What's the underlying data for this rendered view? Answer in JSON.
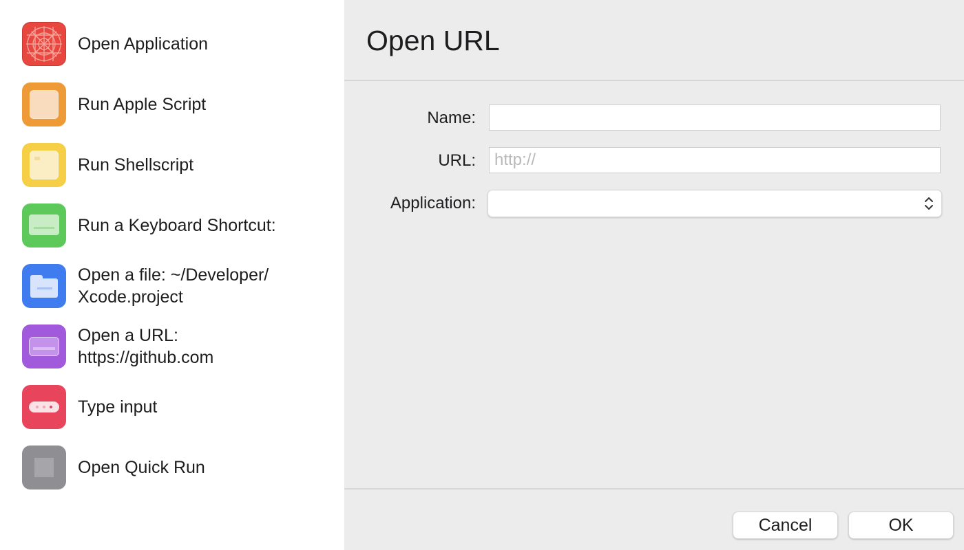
{
  "sidebar": {
    "actions": [
      {
        "label": "Open Application",
        "icon": "open-application-icon",
        "color": "#e8473f"
      },
      {
        "label": "Run Apple Script",
        "icon": "apple-script-icon",
        "color": "#ee9a37"
      },
      {
        "label": "Run Shellscript",
        "icon": "shellscript-icon",
        "color": "#f6cf46"
      },
      {
        "label": "Run a Keyboard Shortcut:",
        "icon": "keyboard-icon",
        "color": "#5dc95a"
      },
      {
        "label": "Open a file: ~/Developer/\nXcode.project",
        "icon": "folder-icon",
        "color": "#3f7cf0"
      },
      {
        "label": "Open a URL:\nhttps://github.com",
        "icon": "url-icon",
        "color": "#a05adb"
      },
      {
        "label": "Type input",
        "icon": "type-input-icon",
        "color": "#e8455c"
      },
      {
        "label": "Open Quick Run",
        "icon": "quick-run-icon",
        "color": "#8e8e93"
      }
    ]
  },
  "dialog": {
    "title": "Open URL",
    "name_label": "Name:",
    "name_value": "",
    "url_label": "URL:",
    "url_placeholder": "http://",
    "application_label": "Application:",
    "application_value": "",
    "cancel_label": "Cancel",
    "ok_label": "OK"
  }
}
